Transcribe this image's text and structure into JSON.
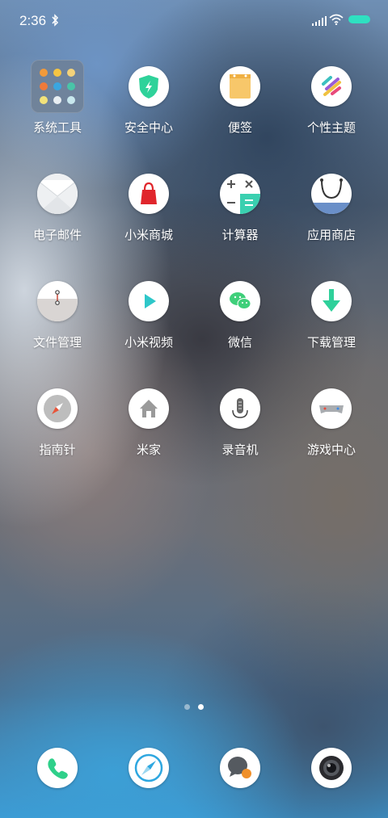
{
  "status_bar": {
    "time": "2:36",
    "bluetooth_icon": "bluetooth-icon",
    "signal_icon": "cellular-signal-icon",
    "wifi_icon": "wifi-icon",
    "battery_icon": "battery-icon",
    "battery_color": "#2fe0c1"
  },
  "apps": [
    {
      "label": "系统工具",
      "icon": "folder-icon"
    },
    {
      "label": "安全中心",
      "icon": "security-shield-icon"
    },
    {
      "label": "便签",
      "icon": "notes-icon"
    },
    {
      "label": "个性主题",
      "icon": "themes-icon"
    },
    {
      "label": "电子邮件",
      "icon": "email-icon"
    },
    {
      "label": "小米商城",
      "icon": "shopping-bag-icon"
    },
    {
      "label": "计算器",
      "icon": "calculator-icon"
    },
    {
      "label": "应用商店",
      "icon": "app-store-icon"
    },
    {
      "label": "文件管理",
      "icon": "file-manager-icon"
    },
    {
      "label": "小米视频",
      "icon": "video-play-icon"
    },
    {
      "label": "微信",
      "icon": "wechat-icon"
    },
    {
      "label": "下载管理",
      "icon": "download-icon"
    },
    {
      "label": "指南针",
      "icon": "compass-icon"
    },
    {
      "label": "米家",
      "icon": "home-icon"
    },
    {
      "label": "录音机",
      "icon": "recorder-icon"
    },
    {
      "label": "游戏中心",
      "icon": "game-center-icon"
    }
  ],
  "page_indicator": {
    "pages": 2,
    "current": 2
  },
  "dock": [
    {
      "icon": "phone-icon"
    },
    {
      "icon": "browser-compass-icon"
    },
    {
      "icon": "messages-icon"
    },
    {
      "icon": "camera-icon"
    }
  ]
}
